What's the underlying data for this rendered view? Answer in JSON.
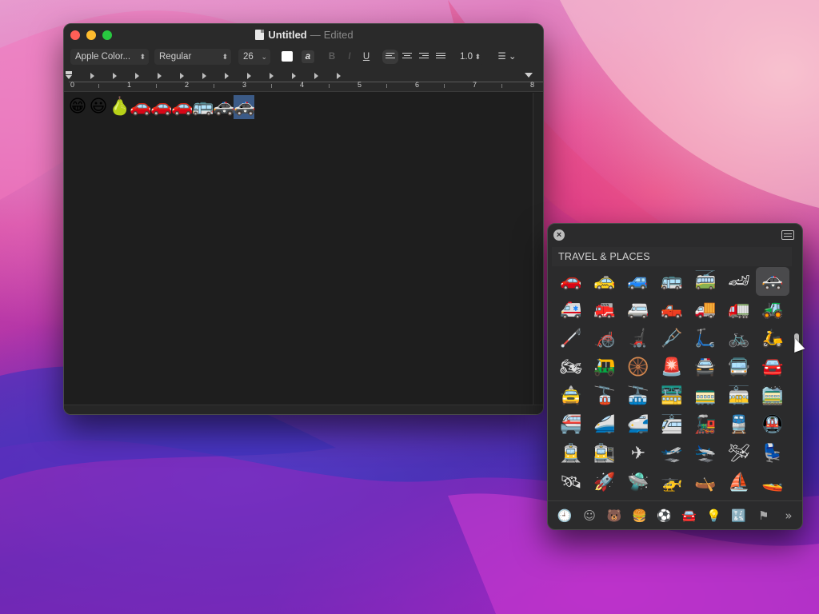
{
  "editor": {
    "title": "Untitled",
    "title_separator": "—",
    "status": "Edited",
    "toolbar": {
      "font_family": "Apple Color...",
      "font_style": "Regular",
      "font_size": "26",
      "line_spacing": "1.0",
      "bold_label": "B",
      "italic_label": "I",
      "underline_label": "U",
      "text_color_label": "a"
    },
    "ruler_numbers": [
      "0",
      "1",
      "2",
      "3",
      "4",
      "5",
      "6",
      "7",
      "8"
    ],
    "content": [
      "😁",
      "😃",
      "🍐",
      "🚗",
      "🚗",
      "🚗",
      "🚌",
      "🚓",
      "🚓"
    ]
  },
  "picker": {
    "section_title": "TRAVEL & PLACES",
    "emojis": [
      "🚗",
      "🚕",
      "🚙",
      "🚌",
      "🚎",
      "🏎",
      "🚓",
      "🚑",
      "🚒",
      "🚐",
      "🛻",
      "🚚",
      "🚛",
      "🚜",
      "🦯",
      "🦽",
      "🦼",
      "🩼",
      "🛴",
      "🚲",
      "🛵",
      "🏍",
      "🛺",
      "🛞",
      "🚨",
      "🚔",
      "🚍",
      "🚘",
      "🚖",
      "🚡",
      "🚠",
      "🚟",
      "🚃",
      "🚋",
      "🚞",
      "🚝",
      "🚄",
      "🚅",
      "🚈",
      "🚂",
      "🚆",
      "🚇",
      "🚊",
      "🚉",
      "✈",
      "🛫",
      "🛬",
      "🛩",
      "💺",
      "🛰",
      "🚀",
      "🛸",
      "🚁",
      "🛶",
      "⛵",
      "🚤"
    ],
    "selected_index": 6,
    "categories": [
      {
        "name": "recents",
        "glyph": "🕘"
      },
      {
        "name": "smileys",
        "glyph": "☺"
      },
      {
        "name": "animals",
        "glyph": "🐻"
      },
      {
        "name": "food",
        "glyph": "🍔"
      },
      {
        "name": "activity",
        "glyph": "⚽"
      },
      {
        "name": "travel",
        "glyph": "🚘"
      },
      {
        "name": "objects",
        "glyph": "💡"
      },
      {
        "name": "symbols",
        "glyph": "🔣"
      },
      {
        "name": "flags",
        "glyph": "⚑"
      },
      {
        "name": "more",
        "glyph": "»"
      }
    ],
    "active_category": "travel"
  }
}
